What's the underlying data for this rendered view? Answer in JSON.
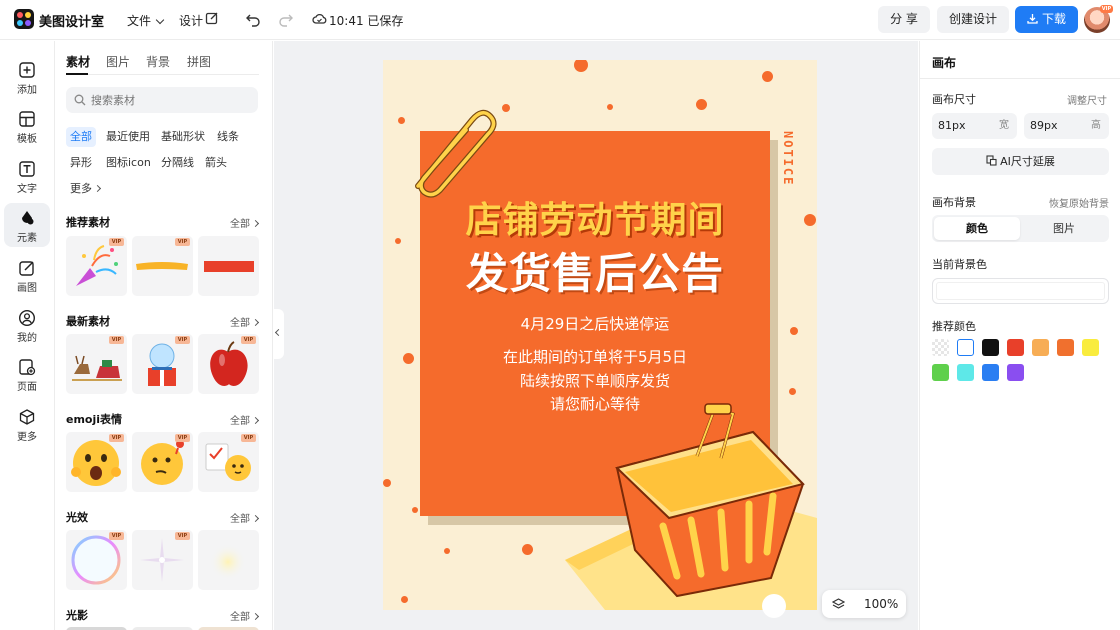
{
  "app": {
    "name": "美图设计室"
  },
  "topbar": {
    "file_label": "文件",
    "design_label": "设计",
    "save_status": "10:41 已保存",
    "share_label": "分 享",
    "create_label": "创建设计",
    "download_label": "下载",
    "avatar_badge": "VIP"
  },
  "rail": {
    "items": [
      {
        "label": "添加",
        "icon": "plus-square-icon"
      },
      {
        "label": "模板",
        "icon": "template-icon"
      },
      {
        "label": "文字",
        "icon": "text-icon"
      },
      {
        "label": "元素",
        "icon": "shapes-icon"
      },
      {
        "label": "画图",
        "icon": "draw-icon"
      },
      {
        "label": "我的",
        "icon": "user-icon"
      },
      {
        "label": "页面",
        "icon": "page-add-icon"
      },
      {
        "label": "更多",
        "icon": "cube-icon"
      }
    ],
    "active": "元素"
  },
  "panel": {
    "tabs": [
      "素材",
      "图片",
      "背景",
      "拼图"
    ],
    "search_placeholder": "搜索素材",
    "chips": [
      "全部",
      "最近使用",
      "基础形状",
      "线条",
      "异形",
      "图标icon",
      "分隔线",
      "箭头",
      "更多"
    ],
    "all_label": "全部",
    "vip_label": "VIP",
    "sections": {
      "recommended": "推荐素材",
      "latest": "最新素材",
      "emoji": "emoji表情",
      "light": "光效",
      "shadow": "光影"
    }
  },
  "poster": {
    "notice": "NOTICE",
    "title_line1": "店铺劳动节期间",
    "title_line2": "发货售后公告",
    "subline": "4月29日之后快递停运",
    "body": [
      "在此期间的订单将于5月5日",
      "陆续按照下单顺序发货",
      "请您耐心等待"
    ],
    "colors": {
      "background": "#fbefd4",
      "card": "#f56b2c",
      "title_yellow": "#ffd34a"
    }
  },
  "zoom": {
    "level": "100%"
  },
  "rpanel": {
    "title": "画布",
    "size_label": "画布尺寸",
    "adjust_size": "调整尺寸",
    "width_value": "81px",
    "width_unit": "宽",
    "height_value": "89px",
    "height_unit": "高",
    "ai_extend": "AI尺寸延展",
    "bg_label": "画布背景",
    "restore_bg": "恢复原始背景",
    "seg_color": "颜色",
    "seg_image": "图片",
    "current_bg_label": "当前背景色",
    "recommended_colors_label": "推荐颜色",
    "swatches": [
      "transparent",
      "#ffffff",
      "#111111",
      "#e8402a",
      "#f7ad55",
      "#f0702e",
      "#f9ec3e",
      "#5fd04c",
      "#5ee8e8",
      "#2a7ef2",
      "#8a4ef0"
    ]
  }
}
